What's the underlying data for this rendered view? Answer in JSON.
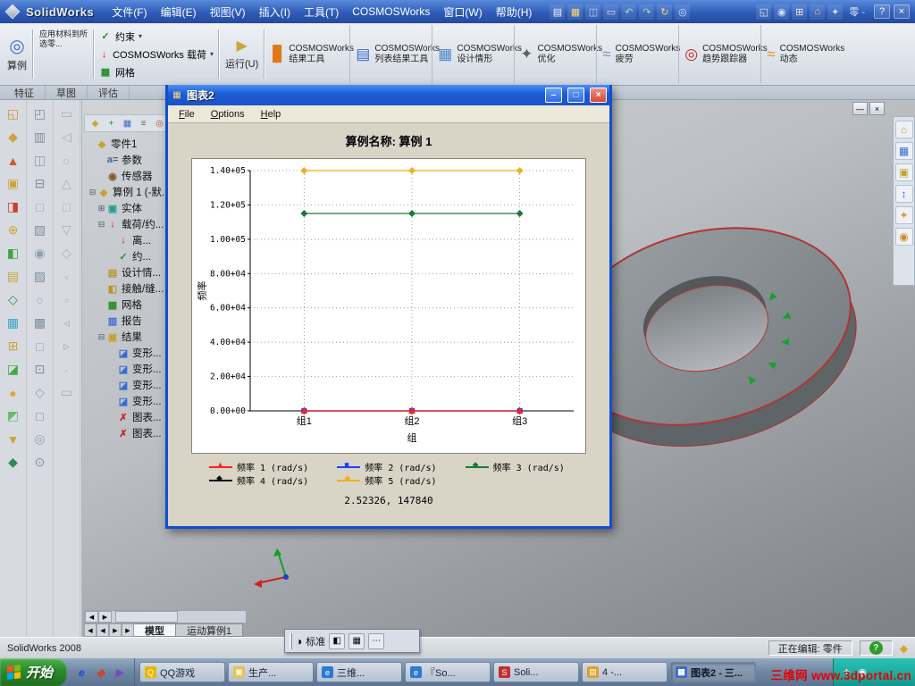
{
  "titlebar": {
    "app_name": "SolidWorks",
    "menus": [
      "文件(F)",
      "编辑(E)",
      "视图(V)",
      "插入(I)",
      "工具(T)",
      "COSMOSWorks",
      "窗口(W)",
      "帮助(H)"
    ],
    "std_icons": [
      {
        "g": "▤",
        "c": "#f4f7fa"
      },
      {
        "g": "▦",
        "c": "#ffd76e"
      },
      {
        "g": "◫",
        "c": "#bcd4ff"
      },
      {
        "g": "▭",
        "c": "#e8e8e8"
      },
      {
        "g": "↶",
        "c": "#a8e0a8"
      },
      {
        "g": "↷",
        "c": "#a8e0a8"
      },
      {
        "g": "↻",
        "c": "#ffd76e"
      },
      {
        "g": "◎",
        "c": "#cfe0ff"
      }
    ],
    "view_icons": [
      {
        "g": "◱",
        "c": "#e8e8e8"
      },
      {
        "g": "◉",
        "c": "#cfe0ff"
      },
      {
        "g": "⊞",
        "c": "#e8e8e8"
      },
      {
        "g": "⌂",
        "c": "#ffd76e"
      },
      {
        "g": "✦",
        "c": "#cfe0ff"
      }
    ],
    "doc_text": "零 -",
    "controls": [
      "?",
      "×"
    ]
  },
  "command_tabs": [
    "特征",
    "草图",
    "评估"
  ],
  "cosmos_toolbar": {
    "study": {
      "icon": "◎",
      "label": "算例"
    },
    "material": {
      "label": "应用材料到所选零..."
    },
    "stack": [
      {
        "icon": "✓",
        "color": "#2a8a2a",
        "label": "约束",
        "arrow": "▾"
      },
      {
        "icon": "↓",
        "color": "#cc2222",
        "label": "COSMOSWorks 载荷",
        "arrow": "▾"
      },
      {
        "icon": "▦",
        "color": "#2a8a2a",
        "label": "网格",
        "arrow": ""
      }
    ],
    "run": {
      "icon": "▶",
      "label": "运行(U)"
    },
    "buttons": [
      {
        "icon": "▊",
        "color": "#e07818",
        "line1": "COSMOSWorks",
        "line2": "结果工具"
      },
      {
        "icon": "▤",
        "color": "#3a6ad4",
        "line1": "COSMOSWorks",
        "line2": "列表结果工具"
      },
      {
        "icon": "▦",
        "color": "#4a88c8",
        "line1": "COSMOSWorks",
        "line2": "设计情形"
      },
      {
        "icon": "✦",
        "color": "#606060",
        "line1": "COSMOSWorks",
        "line2": "优化"
      },
      {
        "icon": "≈",
        "color": "#7a8ab0",
        "line1": "COSMOSWorks",
        "line2": "疲劳"
      },
      {
        "icon": "◎",
        "color": "#cc2222",
        "line1": "COSMOSWorks",
        "line2": "趋势跟踪器"
      },
      {
        "icon": "≈",
        "color": "#e09018",
        "line1": "COSMOSWorks",
        "line2": "动态"
      }
    ]
  },
  "left_icons": {
    "col1": [
      {
        "g": "◱",
        "c": "#d9932b"
      },
      {
        "g": "◆",
        "c": "#caa53a"
      },
      {
        "g": "▲",
        "c": "#c85a2e"
      },
      {
        "g": "▣",
        "c": "#caa53a"
      },
      {
        "g": "◨",
        "c": "#cc3b33"
      },
      {
        "g": "⊕",
        "c": "#caa53a"
      },
      {
        "g": "◧",
        "c": "#3da53d"
      },
      {
        "g": "▤",
        "c": "#caa53a"
      },
      {
        "g": "◇",
        "c": "#2e8b57"
      },
      {
        "g": "▦",
        "c": "#3da5c4"
      },
      {
        "g": "⊞",
        "c": "#caa53a"
      },
      {
        "g": "◪",
        "c": "#44aa44"
      },
      {
        "g": "●",
        "c": "#ddaa33"
      },
      {
        "g": "◩",
        "c": "#66bb66"
      },
      {
        "g": "▼",
        "c": "#caa53a"
      },
      {
        "g": "◆",
        "c": "#2e8b57"
      }
    ],
    "col2": [
      {
        "g": "◰",
        "c": "#7f8ea0"
      },
      {
        "g": "▥",
        "c": "#7f8ea0"
      },
      {
        "g": "◫",
        "c": "#8f9eae"
      },
      {
        "g": "⊟",
        "c": "#7f8ea0"
      },
      {
        "g": "□",
        "c": "#93a2b2"
      },
      {
        "g": "▧",
        "c": "#7f8ea0"
      },
      {
        "g": "◉",
        "c": "#8f9eae"
      },
      {
        "g": "▨",
        "c": "#7f8ea0"
      },
      {
        "g": "○",
        "c": "#93a2b2"
      },
      {
        "g": "▩",
        "c": "#7f8ea0"
      },
      {
        "g": "□",
        "c": "#8f9eae"
      },
      {
        "g": "⊡",
        "c": "#7f8ea0"
      },
      {
        "g": "◇",
        "c": "#93a2b2"
      },
      {
        "g": "□",
        "c": "#7f8ea0"
      },
      {
        "g": "◎",
        "c": "#8f9eae"
      },
      {
        "g": "⊙",
        "c": "#7f8ea0"
      }
    ],
    "col3": [
      {
        "g": "▭",
        "c": "#a9b0b8"
      },
      {
        "g": "◁",
        "c": "#a9b0b8"
      },
      {
        "g": "○",
        "c": "#a9b0b8"
      },
      {
        "g": "△",
        "c": "#a9b0b8"
      },
      {
        "g": "□",
        "c": "#a9b0b8"
      },
      {
        "g": "▽",
        "c": "#a9b0b8"
      },
      {
        "g": "◇",
        "c": "#a9b0b8"
      },
      {
        "g": "◦",
        "c": "#a9b0b8"
      },
      {
        "g": "▫",
        "c": "#a9b0b8"
      },
      {
        "g": "◃",
        "c": "#a9b0b8"
      },
      {
        "g": "▹",
        "c": "#a9b0b8"
      },
      {
        "g": "∙",
        "c": "#a9b0b8"
      },
      {
        "g": "▭",
        "c": "#a9b0b8"
      }
    ]
  },
  "tree": {
    "header_icons": [
      {
        "g": "◆",
        "c": "#caa53a"
      },
      {
        "g": "+",
        "c": "#2a8a2a"
      },
      {
        "g": "▦",
        "c": "#3a6ad4"
      },
      {
        "g": "≡",
        "c": "#666666"
      },
      {
        "g": "◎",
        "c": "#b05a2a"
      },
      {
        "g": "✦",
        "c": "#8a5ac0"
      }
    ],
    "items": [
      {
        "exp": "",
        "icon": "◆",
        "color": "#c8a22e",
        "pad": "2px",
        "label": "零件1"
      },
      {
        "exp": "",
        "icon": "a=",
        "color": "#50618a",
        "pad": "14px",
        "label": "参数"
      },
      {
        "exp": "",
        "icon": "◉",
        "color": "#8a5a2a",
        "pad": "14px",
        "label": "传感器"
      },
      {
        "exp": "⊟",
        "icon": "◆",
        "color": "#c8a22e",
        "pad": "4px",
        "label": "算例 1 (-默..."
      },
      {
        "exp": "⊞",
        "icon": "▣",
        "color": "#2a9d8f",
        "pad": "14px",
        "label": "实体"
      },
      {
        "exp": "⊟",
        "icon": "↓",
        "color": "#cc2222",
        "pad": "14px",
        "label": "载荷/约..."
      },
      {
        "exp": "",
        "icon": "↓",
        "color": "#cc2222",
        "pad": "26px",
        "label": "离..."
      },
      {
        "exp": "",
        "icon": "✓",
        "color": "#2a8a2a",
        "pad": "26px",
        "label": "约..."
      },
      {
        "exp": "",
        "icon": "▤",
        "color": "#b8962e",
        "pad": "14px",
        "label": "设计情..."
      },
      {
        "exp": "",
        "icon": "◧",
        "color": "#b8962e",
        "pad": "14px",
        "label": "接触/缝..."
      },
      {
        "exp": "",
        "icon": "▦",
        "color": "#2a8a2a",
        "pad": "14px",
        "label": "网格"
      },
      {
        "exp": "",
        "icon": "▥",
        "color": "#3a6ad4",
        "pad": "14px",
        "label": "报告"
      },
      {
        "exp": "⊟",
        "icon": "▣",
        "color": "#c8a22e",
        "pad": "14px",
        "label": "结果"
      },
      {
        "exp": "",
        "icon": "◪",
        "color": "#3a6ad4",
        "pad": "26px",
        "label": "变形..."
      },
      {
        "exp": "",
        "icon": "◪",
        "color": "#3a6ad4",
        "pad": "26px",
        "label": "变形..."
      },
      {
        "exp": "",
        "icon": "◪",
        "color": "#3a6ad4",
        "pad": "26px",
        "label": "变形..."
      },
      {
        "exp": "",
        "icon": "◪",
        "color": "#3a6ad4",
        "pad": "26px",
        "label": "变形..."
      },
      {
        "exp": "",
        "icon": "✗",
        "color": "#cc2222",
        "pad": "26px",
        "label": "图表..."
      },
      {
        "exp": "",
        "icon": "✗",
        "color": "#cc2222",
        "pad": "26px",
        "label": "图表..."
      }
    ]
  },
  "viewport": {
    "doc_controls": [
      "—",
      "×"
    ]
  },
  "task_pane": {
    "icons": [
      {
        "g": "⌂",
        "c": "#c8962e"
      },
      {
        "g": "▦",
        "c": "#3a6ad4"
      },
      {
        "g": "▣",
        "c": "#c8a22e"
      },
      {
        "g": "↕",
        "c": "#3a6ad4"
      },
      {
        "g": "✦",
        "c": "#c8a22e"
      },
      {
        "g": "◉",
        "c": "#cc8a2a"
      }
    ]
  },
  "dialog": {
    "icon": "▦",
    "title": "图表2",
    "menus": [
      "File",
      "Options",
      "Help"
    ],
    "buttons": [
      {
        "g": "–"
      },
      {
        "g": "□"
      },
      {
        "g": "×",
        "cls": "close"
      }
    ]
  },
  "chart_data": {
    "type": "line",
    "title": "算例名称: 算例 1",
    "xlabel": "组",
    "ylabel": "频率",
    "categories": [
      "组1",
      "组2",
      "组3"
    ],
    "ylim": [
      0,
      140000
    ],
    "ytick_labels": [
      "0.00+00",
      "2.00+04",
      "4.00+04",
      "6.00+04",
      "8.00+04",
      "1.00+05",
      "1.20+05",
      "1.40+05"
    ],
    "grid": true,
    "legend_position": "bottom",
    "series": [
      {
        "name": "频率 1 (rad/s)",
        "color": "#ff2020",
        "marker": "triangle",
        "glyph": "▲",
        "values": [
          0,
          0,
          0
        ]
      },
      {
        "name": "频率 2 (rad/s)",
        "color": "#2040ff",
        "marker": "square",
        "glyph": "■",
        "values": [
          0,
          0,
          0
        ]
      },
      {
        "name": "频率 3 (rad/s)",
        "color": "#1a7a3a",
        "marker": "diamond",
        "glyph": "◆",
        "values": [
          115000,
          115000,
          115000
        ]
      },
      {
        "name": "频率 4 (rad/s)",
        "color": "#101010",
        "marker": "diamond",
        "glyph": "◆",
        "values": [
          0,
          0,
          0
        ]
      },
      {
        "name": "频率 5 (rad/s)",
        "color": "#f0b020",
        "marker": "diamond",
        "glyph": "◆",
        "values": [
          140000,
          140000,
          140000
        ]
      }
    ],
    "cursor_readout": "2.52326, 147840"
  },
  "bottom": {
    "hscroll_arrows": [
      "◀",
      "▶"
    ],
    "nav": [
      "◀",
      "◀",
      "▶",
      "▶"
    ],
    "tabs": [
      {
        "label": "模型",
        "active": true
      },
      {
        "label": "运动算例1"
      }
    ]
  },
  "float_toolbar": {
    "grip_icon": "◑",
    "label": "标准",
    "icons": [
      {
        "g": "◧"
      },
      {
        "g": "▦"
      },
      {
        "g": "⋯"
      }
    ]
  },
  "statusbar": {
    "app": "SolidWorks 2008",
    "editing": "正在编辑: 零件",
    "help_icon": "?",
    "gem_icon": "◆"
  },
  "taskbar": {
    "start": "开始",
    "quick": [
      {
        "g": "e",
        "c": "#1a4fd0"
      },
      {
        "g": "◆",
        "c": "#cc4433"
      },
      {
        "g": "▶",
        "c": "#7a4ac0"
      }
    ],
    "buttons": [
      {
        "g": "Q",
        "c": "#e8b800",
        "label": "QQ游戏"
      },
      {
        "g": "▣",
        "c": "#e8c050",
        "label": "生产..."
      },
      {
        "g": "e",
        "c": "#2a7ad4",
        "label": "三维..."
      },
      {
        "g": "e",
        "c": "#2a7ad4",
        "label": "『So..."
      },
      {
        "g": "S",
        "c": "#c03030",
        "label": "Soli..."
      },
      {
        "g": "▤",
        "c": "#e0a030",
        "label": "4 -..."
      },
      {
        "g": "▦",
        "c": "#3a6ad4",
        "label": "图表2 - 三...",
        "active": true
      }
    ],
    "tray_icons": [
      {
        "g": "✦",
        "c": "#ffffff"
      },
      {
        "g": "◉",
        "c": "#ffffff"
      }
    ],
    "watermark": "三维网 www.3dportal.cn"
  }
}
